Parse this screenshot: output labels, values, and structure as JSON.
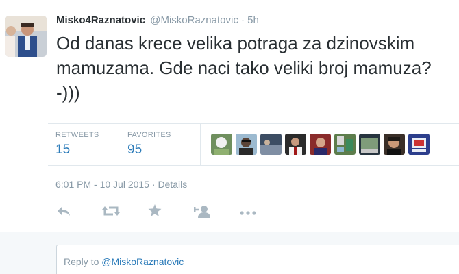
{
  "tweet": {
    "fullname": "Misko4Raznatovic",
    "handle": "@MiskoRaznatovic",
    "separator": "·",
    "time_ago": "5h",
    "text": "Od danas krece velika potraga za dzinovskim mamuzama. Gde naci tako veliki broj mamuza? -)))"
  },
  "stats": {
    "retweets_label": "RETWEETS",
    "retweets_value": "15",
    "favorites_label": "FAVORITES",
    "favorites_value": "95"
  },
  "meta": {
    "datetime": "6:01 PM - 10 Jul 2015",
    "separator": "·",
    "details_link": "Details"
  },
  "actions": [
    "reply-icon",
    "retweet-icon",
    "favorite-icon",
    "follow-icon",
    "more-icon"
  ],
  "reply": {
    "prefix": "Reply to ",
    "mention": "@MiskoRaznatovic"
  },
  "colors": {
    "text": "#292f33",
    "muted": "#8899a6",
    "link": "#2b7bb9",
    "border": "#e1e8ed"
  }
}
